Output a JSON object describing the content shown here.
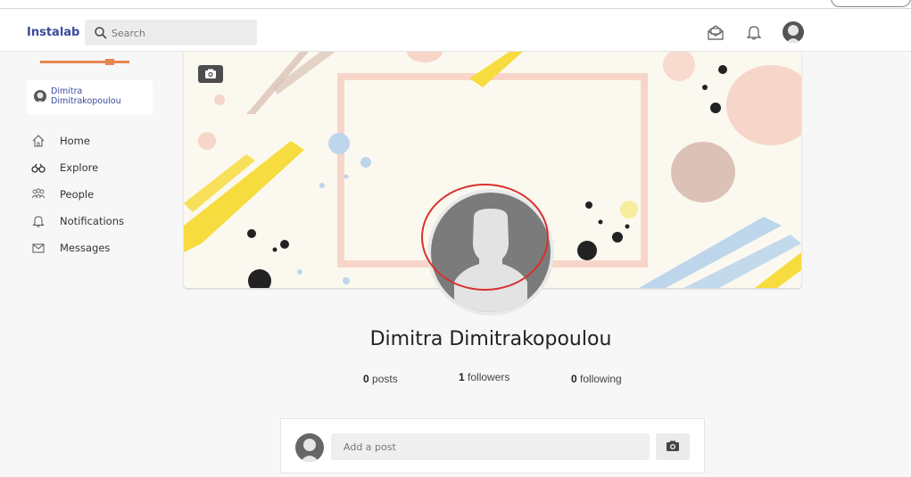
{
  "topbar": {
    "brand": "Instalab",
    "search_placeholder": "Search"
  },
  "sidebar": {
    "user_first": "Dimitra",
    "user_last": "Dimitrakopoulou",
    "nav": [
      {
        "label": "Home",
        "icon": "home-icon"
      },
      {
        "label": "Explore",
        "icon": "binoculars-icon"
      },
      {
        "label": "People",
        "icon": "people-icon"
      },
      {
        "label": "Notifications",
        "icon": "bell-icon"
      },
      {
        "label": "Messages",
        "icon": "envelope-icon"
      }
    ]
  },
  "profile": {
    "name": "Dimitra Dimitrakopoulou",
    "posts_count": "0",
    "posts_label": "posts",
    "followers_count": "1",
    "followers_label": "followers",
    "following_count": "0",
    "following_label": "following"
  },
  "composer": {
    "placeholder": "Add a post"
  },
  "colors": {
    "brand": "#3b4a9c",
    "accent_orange": "#e8854e",
    "highlight_ring": "#d9302c"
  }
}
